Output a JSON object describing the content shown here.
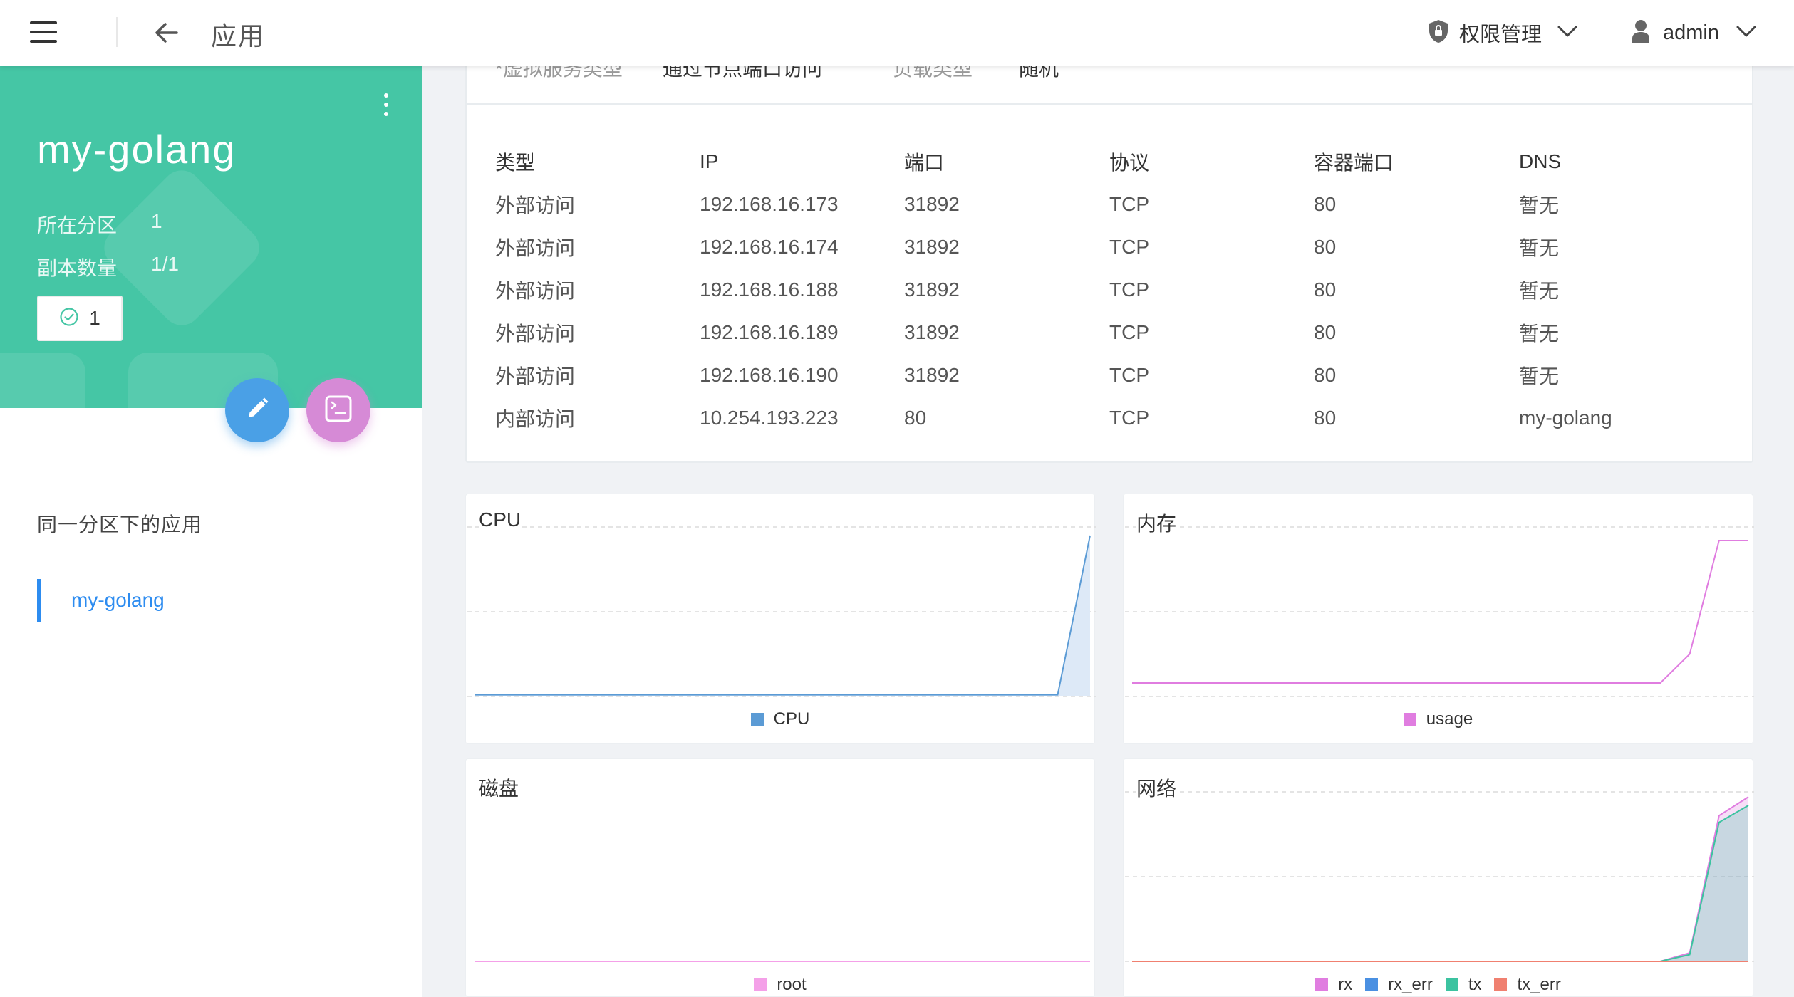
{
  "header": {
    "title": "应用",
    "permission_label": "权限管理",
    "user_name": "admin"
  },
  "app": {
    "name": "my-golang",
    "partition_label": "所在分区",
    "partition_value": "1",
    "replica_label": "副本数量",
    "replica_value": "1/1",
    "running_count": "1",
    "same_partition_title": "同一分区下的应用",
    "same_partition_apps": [
      "my-golang"
    ]
  },
  "service_tabs": [
    "*虚拟服务类型",
    "通过节点端口访问",
    "负载类型",
    "随机"
  ],
  "service_table": {
    "headers": [
      "类型",
      "IP",
      "端口",
      "协议",
      "容器端口",
      "DNS"
    ],
    "rows": [
      [
        "外部访问",
        "192.168.16.173",
        "31892",
        "TCP",
        "80",
        "暂无"
      ],
      [
        "外部访问",
        "192.168.16.174",
        "31892",
        "TCP",
        "80",
        "暂无"
      ],
      [
        "外部访问",
        "192.168.16.188",
        "31892",
        "TCP",
        "80",
        "暂无"
      ],
      [
        "外部访问",
        "192.168.16.189",
        "31892",
        "TCP",
        "80",
        "暂无"
      ],
      [
        "外部访问",
        "192.168.16.190",
        "31892",
        "TCP",
        "80",
        "暂无"
      ],
      [
        "内部访问",
        "10.254.193.223",
        "80",
        "TCP",
        "80",
        "my-golang"
      ]
    ]
  },
  "colors": {
    "accent_green": "#45c6a5",
    "link_blue": "#2d8cf0",
    "edit_fab": "#4aa0e6",
    "terminal_fab": "#d68ad6",
    "status_ok": "#45c6a5"
  },
  "icons": {
    "menu": "hamburger-icon",
    "back": "arrow-left-icon",
    "permission": "shield-lock-icon",
    "user": "user-icon",
    "dropdown": "chevron-down-icon",
    "more": "kebab-icon",
    "status": "check-circle-icon",
    "edit": "pencil-icon",
    "terminal": "terminal-icon"
  },
  "chart_data": [
    {
      "type": "area",
      "title": "CPU",
      "x": [
        0,
        1,
        2,
        3,
        4,
        5,
        6,
        7,
        8,
        9,
        10,
        11,
        12,
        13,
        14,
        15,
        16,
        17,
        18,
        19
      ],
      "series": [
        {
          "name": "CPU",
          "color": "#5b9bd5",
          "fill": "#dde9f7",
          "values": [
            0.01,
            0.01,
            0.01,
            0.01,
            0.01,
            0.01,
            0.01,
            0.01,
            0.01,
            0.01,
            0.01,
            0.01,
            0.01,
            0.01,
            0.01,
            0.01,
            0.01,
            0.01,
            0.01,
            0.95
          ]
        }
      ],
      "ylim": [
        0,
        1
      ],
      "grid": true,
      "legend": "bottom"
    },
    {
      "type": "line",
      "title": "内存",
      "x": [
        0,
        1,
        2,
        3,
        4,
        5,
        6,
        7,
        8,
        9,
        10,
        11,
        12,
        13,
        14,
        15,
        16,
        17,
        18,
        19,
        20
      ],
      "series": [
        {
          "name": "usage",
          "color": "#e07de0",
          "values": [
            0.08,
            0.08,
            0.08,
            0.08,
            0.08,
            0.08,
            0.08,
            0.08,
            0.08,
            0.08,
            0.08,
            0.08,
            0.08,
            0.08,
            0.08,
            0.08,
            0.08,
            0.08,
            0.08,
            0.25,
            0.92,
            0.92
          ]
        }
      ],
      "ylim": [
        0,
        1
      ],
      "grid": true,
      "legend": "bottom"
    },
    {
      "type": "line",
      "title": "磁盘",
      "x": [
        0,
        1
      ],
      "series": [
        {
          "name": "root",
          "color": "#f4a0e8",
          "values": [
            0,
            0
          ]
        }
      ],
      "ylim": [
        0,
        1
      ],
      "grid": false,
      "legend": "bottom"
    },
    {
      "type": "area",
      "title": "网络",
      "x": [
        0,
        1,
        2,
        3,
        4,
        5,
        6,
        7,
        8,
        9,
        10,
        11,
        12,
        13,
        14,
        15,
        16,
        17,
        18,
        19,
        20,
        21
      ],
      "series": [
        {
          "name": "rx",
          "color": "#e07de0",
          "values": [
            0,
            0,
            0,
            0,
            0,
            0,
            0,
            0,
            0,
            0,
            0,
            0,
            0,
            0,
            0,
            0,
            0,
            0,
            0,
            0.05,
            0.86,
            0.97
          ]
        },
        {
          "name": "rx_err",
          "color": "#4a90e2",
          "values": [
            0,
            0,
            0,
            0,
            0,
            0,
            0,
            0,
            0,
            0,
            0,
            0,
            0,
            0,
            0,
            0,
            0,
            0,
            0,
            0,
            0,
            0
          ]
        },
        {
          "name": "tx",
          "color": "#3cc3a0",
          "values": [
            0,
            0,
            0,
            0,
            0,
            0,
            0,
            0,
            0,
            0,
            0,
            0,
            0,
            0,
            0,
            0,
            0,
            0,
            0,
            0.04,
            0.82,
            0.92
          ]
        },
        {
          "name": "tx_err",
          "color": "#f08070",
          "values": [
            0,
            0,
            0,
            0,
            0,
            0,
            0,
            0,
            0,
            0,
            0,
            0,
            0,
            0,
            0,
            0,
            0,
            0,
            0,
            0,
            0,
            0
          ]
        }
      ],
      "ylim": [
        0,
        1
      ],
      "grid": true,
      "legend": "bottom"
    }
  ]
}
